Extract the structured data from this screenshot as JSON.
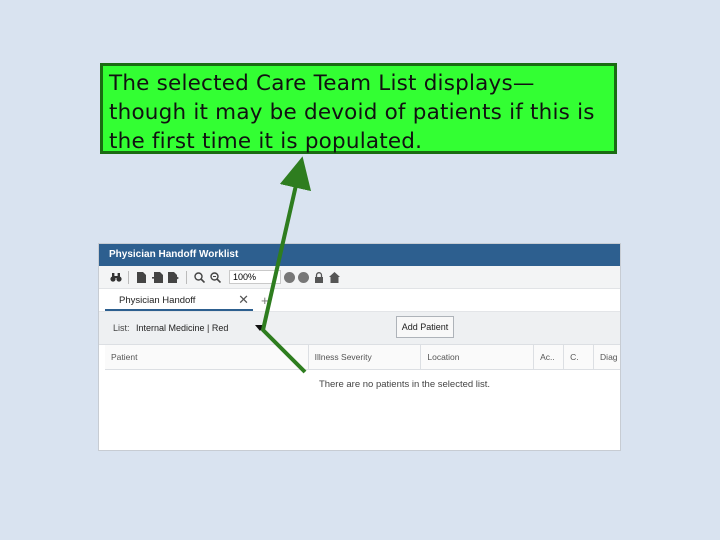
{
  "callout": {
    "lines": [
      "The selected Care Team List displays—",
      "though it may be devoid of patients if this is",
      "the first time it is populated."
    ]
  },
  "colors": {
    "callout_bg": "#33ff33",
    "callout_border": "#1a6b12",
    "arrow": "#2e7d1f",
    "titlebar": "#2d5f8f"
  },
  "window": {
    "title": "Physician Handoff Worklist",
    "toolbar": {
      "icons": [
        "binoculars-icon",
        "page-icon",
        "page-add-icon",
        "page-forward-icon",
        "zoom-in-icon",
        "zoom-out-icon"
      ],
      "zoom": "100%",
      "right_icons": [
        "circle-icon",
        "circle-icon",
        "lock-icon",
        "home-icon"
      ]
    },
    "tab": {
      "label": "Physician Handoff",
      "close": "✕",
      "add": "+"
    },
    "list": {
      "label": "List:",
      "value": "Internal Medicine | Red",
      "add_button": "Add Patient"
    },
    "columns": [
      "Patient",
      "Illness Severity",
      "Location",
      "Ac..",
      "C.",
      "Diag"
    ],
    "empty_message": "There are no patients in the selected list."
  }
}
